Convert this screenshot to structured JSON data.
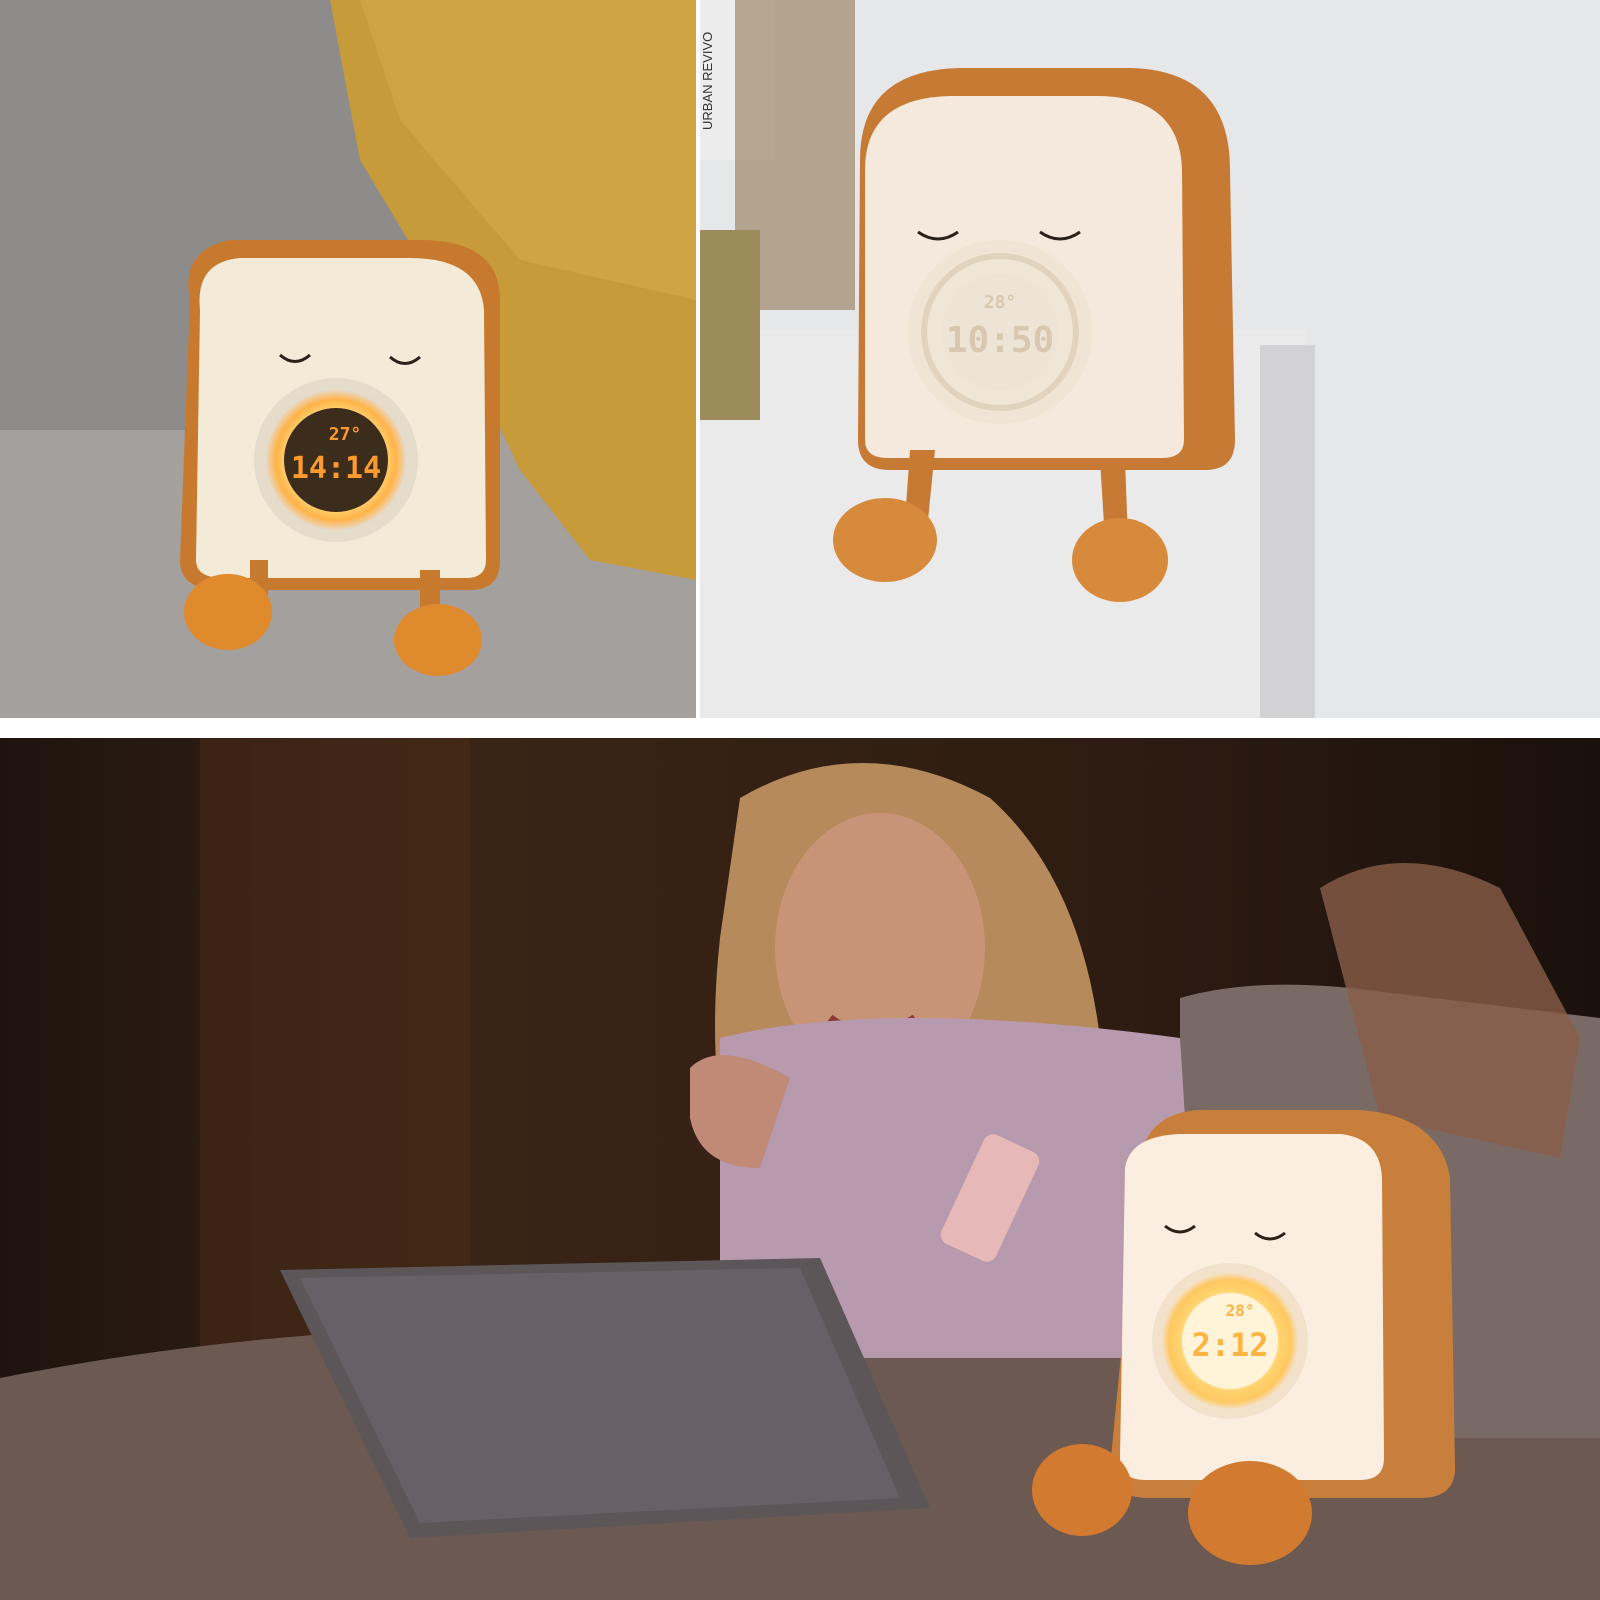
{
  "photos": [
    {
      "clock_temp": "27°",
      "clock_time": "14:14",
      "colors": {
        "glow": "#ffb347",
        "digits": "#ff9a2e"
      }
    },
    {
      "book_spine": "URBAN REVIVO",
      "clock_temp": "28°",
      "clock_time": "10:50",
      "colors": {
        "glow": "#f4ead8",
        "digits": "#d8c8b0"
      }
    },
    {
      "clock_temp": "28°",
      "clock_time": "2:12",
      "colors": {
        "glow": "#ffc861",
        "digits": "#ffb340"
      }
    }
  ]
}
